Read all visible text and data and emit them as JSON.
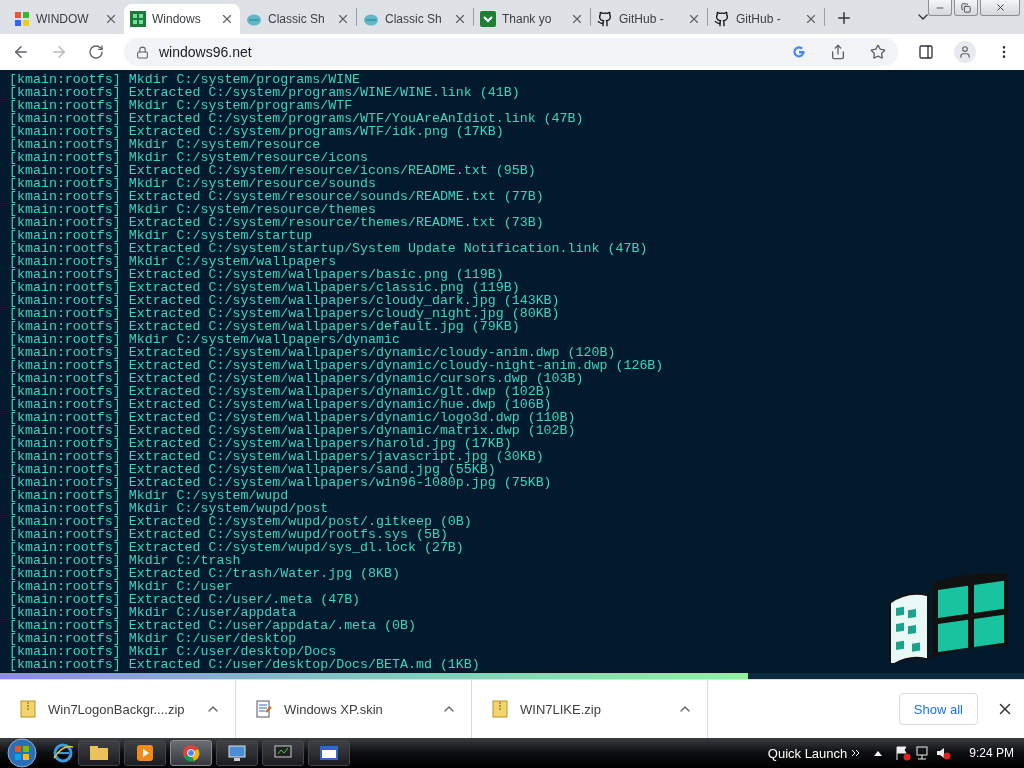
{
  "browser": {
    "tabs": [
      {
        "title": "WINDOW",
        "kind": "tiles",
        "selected": false
      },
      {
        "title": "Windows",
        "kind": "grid",
        "selected": true
      },
      {
        "title": "Classic Sh",
        "kind": "shell",
        "selected": false
      },
      {
        "title": "Classic Sh",
        "kind": "shell",
        "selected": false
      },
      {
        "title": "Thank yo",
        "kind": "check",
        "selected": false
      },
      {
        "title": "GitHub -",
        "kind": "github",
        "selected": false
      },
      {
        "title": "GitHub -",
        "kind": "github",
        "selected": false
      }
    ],
    "address": "windows96.net"
  },
  "terminal": {
    "lines": [
      "[kmain:rootfs] Mkdir C:/system/programs/WINE",
      "[kmain:rootfs] Extracted C:/system/programs/WINE/WINE.link (41B)",
      "[kmain:rootfs] Mkdir C:/system/programs/WTF",
      "[kmain:rootfs] Extracted C:/system/programs/WTF/YouAreAnIdiot.link (47B)",
      "[kmain:rootfs] Extracted C:/system/programs/WTF/idk.png (17KB)",
      "[kmain:rootfs] Mkdir C:/system/resource",
      "[kmain:rootfs] Mkdir C:/system/resource/icons",
      "[kmain:rootfs] Extracted C:/system/resource/icons/README.txt (95B)",
      "[kmain:rootfs] Mkdir C:/system/resource/sounds",
      "[kmain:rootfs] Extracted C:/system/resource/sounds/README.txt (77B)",
      "[kmain:rootfs] Mkdir C:/system/resource/themes",
      "[kmain:rootfs] Extracted C:/system/resource/themes/README.txt (73B)",
      "[kmain:rootfs] Mkdir C:/system/startup",
      "[kmain:rootfs] Extracted C:/system/startup/System Update Notification.link (47B)",
      "[kmain:rootfs] Mkdir C:/system/wallpapers",
      "[kmain:rootfs] Extracted C:/system/wallpapers/basic.png (119B)",
      "[kmain:rootfs] Extracted C:/system/wallpapers/classic.png (119B)",
      "[kmain:rootfs] Extracted C:/system/wallpapers/cloudy_dark.jpg (143KB)",
      "[kmain:rootfs] Extracted C:/system/wallpapers/cloudy_night.jpg (80KB)",
      "[kmain:rootfs] Extracted C:/system/wallpapers/default.jpg (79KB)",
      "[kmain:rootfs] Mkdir C:/system/wallpapers/dynamic",
      "[kmain:rootfs] Extracted C:/system/wallpapers/dynamic/cloudy-anim.dwp (120B)",
      "[kmain:rootfs] Extracted C:/system/wallpapers/dynamic/cloudy-night-anim.dwp (126B)",
      "[kmain:rootfs] Extracted C:/system/wallpapers/dynamic/cursors.dwp (103B)",
      "[kmain:rootfs] Extracted C:/system/wallpapers/dynamic/glt.dwp (102B)",
      "[kmain:rootfs] Extracted C:/system/wallpapers/dynamic/hue.dwp (106B)",
      "[kmain:rootfs] Extracted C:/system/wallpapers/dynamic/logo3d.dwp (110B)",
      "[kmain:rootfs] Extracted C:/system/wallpapers/dynamic/matrix.dwp (102B)",
      "[kmain:rootfs] Extracted C:/system/wallpapers/harold.jpg (17KB)",
      "[kmain:rootfs] Extracted C:/system/wallpapers/javascript.jpg (30KB)",
      "[kmain:rootfs] Extracted C:/system/wallpapers/sand.jpg (55KB)",
      "[kmain:rootfs] Extracted C:/system/wallpapers/win96-1080p.jpg (75KB)",
      "[kmain:rootfs] Mkdir C:/system/wupd",
      "[kmain:rootfs] Mkdir C:/system/wupd/post",
      "[kmain:rootfs] Extracted C:/system/wupd/post/.gitkeep (0B)",
      "[kmain:rootfs] Extracted C:/system/wupd/rootfs.sys (5B)",
      "[kmain:rootfs] Extracted C:/system/wupd/sys_dl.lock (27B)",
      "[kmain:rootfs] Mkdir C:/trash",
      "[kmain:rootfs] Extracted C:/trash/Water.jpg (8KB)",
      "[kmain:rootfs] Mkdir C:/user",
      "[kmain:rootfs] Extracted C:/user/.meta (47B)",
      "[kmain:rootfs] Mkdir C:/user/appdata",
      "[kmain:rootfs] Extracted C:/user/appdata/.meta (0B)",
      "[kmain:rootfs] Mkdir C:/user/desktop",
      "[kmain:rootfs] Mkdir C:/user/desktop/Docs",
      "[kmain:rootfs] Extracted C:/user/desktop/Docs/BETA.md (1KB)"
    ],
    "progress": {
      "level": 0.73
    }
  },
  "downloads": {
    "items": [
      {
        "name": "Win7LogonBackgr....zip",
        "kind": "zip"
      },
      {
        "name": "Windows XP.skin",
        "kind": "doc"
      },
      {
        "name": "WIN7LIKE.zip",
        "kind": "zip"
      }
    ],
    "show_all": "Show all"
  },
  "taskbar": {
    "quick_launch": "Quick Launch",
    "time": "9:24 PM"
  }
}
